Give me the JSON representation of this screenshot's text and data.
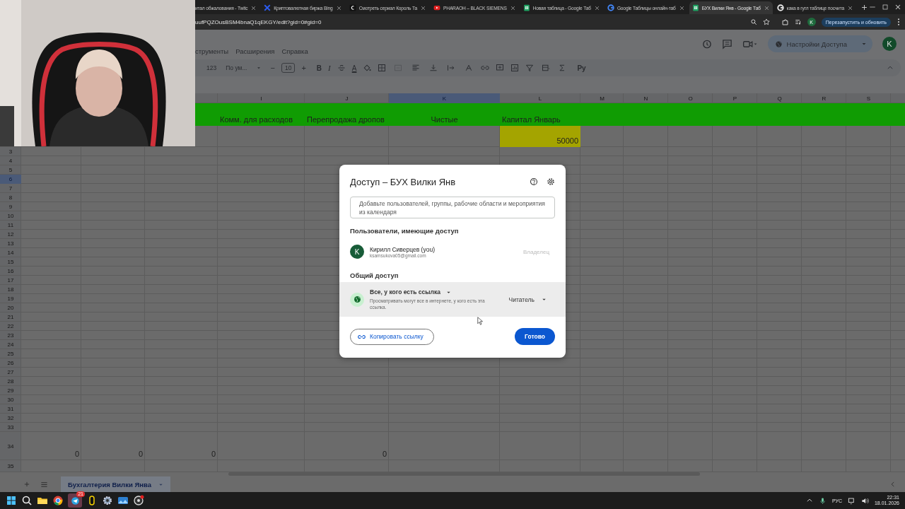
{
  "browser": {
    "tabs": [
      {
        "title": "итал обжалования - Twitc",
        "selected": false
      },
      {
        "title": "Криптовалютная биржа Bing",
        "selected": false
      },
      {
        "title": "Смотреть сериал Король Та",
        "selected": false
      },
      {
        "title": "PHARAOH – BLACK SIEMENS",
        "selected": false
      },
      {
        "title": "Новая таблица - Google Таб",
        "selected": false
      },
      {
        "title": "Google Таблицы онлайн-таб",
        "selected": false
      },
      {
        "title": "БУХ Вилки Янв - Google Таб",
        "selected": true
      },
      {
        "title": "кака в гугл таблице посчита",
        "selected": false
      }
    ],
    "url": "uufPQZOusBSM4bnaQ1qEKGY/edit?gid=0#gid=0",
    "profile": "K",
    "update_button": "Перезапустить и обновить"
  },
  "sheets": {
    "menu": [
      "струменты",
      "Расширения",
      "Справка"
    ],
    "share_button": "Настройки Доступа",
    "avatar": "K",
    "toolbar": {
      "number_format": "123",
      "font": "По ум...",
      "decrease": "−",
      "font_size": "10",
      "increase": "+",
      "bold": "B",
      "italic": "I",
      "text_color": "A",
      "input_tools": "Ру"
    },
    "columns": [
      {
        "label": "I",
        "selected": false
      },
      {
        "label": "J",
        "selected": false
      },
      {
        "label": "K",
        "selected": true
      },
      {
        "label": "L",
        "selected": false
      },
      {
        "label": "M",
        "selected": false
      },
      {
        "label": "N",
        "selected": false
      },
      {
        "label": "O",
        "selected": false
      },
      {
        "label": "P",
        "selected": false
      },
      {
        "label": "Q",
        "selected": false
      },
      {
        "label": "R",
        "selected": false
      },
      {
        "label": "S",
        "selected": false
      }
    ],
    "rows": [
      {
        "color": "#109c03",
        "cells": [
          null,
          null,
          null,
          {
            "text": "Комм. для расходов"
          },
          {
            "text": "Перепродажа дропов"
          },
          {
            "text": "Чистые",
            "kind": "center"
          },
          {
            "text": "Капитал Январь"
          }
        ]
      },
      {
        "cells": [
          null,
          null,
          null,
          null,
          null,
          null,
          {
            "text": "50000",
            "kind": "number",
            "color": "#a4a400"
          }
        ]
      },
      {
        "number": "3",
        "selected": false
      },
      {
        "number": "4",
        "selected": false
      },
      {
        "number": "5",
        "selected": false
      },
      {
        "number": "6",
        "selected": true
      },
      {
        "number": "7",
        "selected": false
      },
      {
        "number": "8",
        "selected": false
      },
      {
        "number": "9",
        "selected": false
      },
      {
        "number": "10",
        "selected": false
      },
      {
        "number": "11",
        "selected": false
      },
      {
        "number": "12",
        "selected": false
      },
      {
        "number": "13",
        "selected": false
      },
      {
        "number": "14",
        "selected": false
      },
      {
        "number": "15",
        "selected": false
      },
      {
        "number": "16",
        "selected": false
      },
      {
        "number": "17",
        "selected": false
      },
      {
        "number": "18",
        "selected": false
      },
      {
        "number": "19",
        "selected": false
      },
      {
        "number": "20",
        "selected": false
      },
      {
        "number": "21",
        "selected": false
      },
      {
        "number": "22",
        "selected": false
      },
      {
        "number": "23",
        "selected": false
      },
      {
        "number": "24",
        "selected": false
      },
      {
        "number": "25",
        "selected": false
      },
      {
        "number": "26",
        "selected": false
      },
      {
        "number": "27",
        "selected": false
      },
      {
        "number": "28",
        "selected": false
      },
      {
        "number": "29",
        "selected": false
      },
      {
        "number": "30",
        "selected": false
      },
      {
        "number": "31",
        "selected": false
      },
      {
        "number": "32",
        "selected": false
      },
      {
        "number": "33",
        "selected": false
      },
      {
        "number": "34",
        "selected": false,
        "cells": [
          {
            "text": "0",
            "kind": "number"
          },
          {
            "text": "0",
            "kind": "number"
          },
          {
            "text": "0",
            "kind": "number"
          },
          null,
          {
            "text": "0",
            "kind": "number"
          }
        ]
      },
      {
        "number": "35",
        "selected": false
      }
    ],
    "sheet_tabs": [
      {
        "label": "Бухгалтерия Вилки Янва",
        "selected": true
      }
    ]
  },
  "dialog": {
    "title": "Доступ – БУХ Вилки Янв",
    "add_field": {
      "placeholder": "Добавьте пользователей, группы, рабочие области и мероприятия из календаря"
    },
    "people_heading": "Пользователи, имеющие доступ",
    "people": [
      {
        "initial": "K",
        "name": "Кирилл Сиверцев (you)",
        "email": "ksamsukova05@gmail.com",
        "role": "Владелец",
        "disabled": true
      }
    ],
    "general_heading": "Общий доступ",
    "access": "Все, у кого есть ссылка",
    "access_description": "Просматривать могут все в интернете, у кого есть эта ссылка.",
    "role": "Читатель",
    "copy_button": "Копировать ссылку",
    "done_button": "Готово"
  },
  "taskbar": {
    "badge": "21",
    "language": "РУС",
    "time": "22:31",
    "date": "18.01.2026"
  }
}
